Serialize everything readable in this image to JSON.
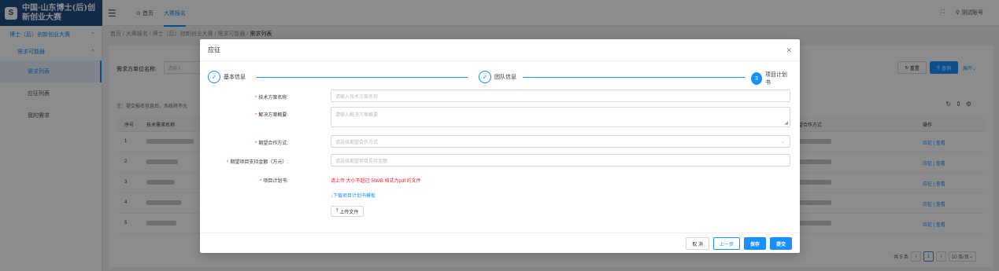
{
  "brand": {
    "logo": "S",
    "title": "中国·山东博士(后)创新创业大赛"
  },
  "header": {
    "tabs": [
      {
        "label": "首页"
      },
      {
        "label": "大赛报名"
      }
    ],
    "account": "测试账号"
  },
  "sidebar": {
    "group": "博士（后）创新创业大赛",
    "sub": "需求可能器",
    "items": [
      {
        "label": "需求列表"
      },
      {
        "label": "应征列表"
      },
      {
        "label": "我的需求"
      }
    ]
  },
  "breadcrumb": "首页 / 大赛报名 / 博士（后）创新创业大赛 / 需求可能器 / ",
  "breadcrumb_last": "需求列表",
  "filter": {
    "label": "需求方单位名称:",
    "placeholder": "请输入",
    "reset": "重置",
    "search": "查询",
    "expand": "展开"
  },
  "notice": "注：提交报名信息后，系统将不允",
  "table": {
    "headers": [
      "序号",
      "技术需求名称",
      "期望合作方式",
      "操作"
    ],
    "rows": [
      {
        "no": "1"
      },
      {
        "no": "2"
      },
      {
        "no": "3"
      },
      {
        "no": "4"
      },
      {
        "no": "5"
      }
    ],
    "op_apply": "应征",
    "op_view": "查看"
  },
  "pager": {
    "total": "共 5 条",
    "page": "1",
    "size": "10 条/页"
  },
  "modal": {
    "title": "应征",
    "steps": [
      {
        "label": "基本信息"
      },
      {
        "label": "团队信息"
      },
      {
        "label": "项目计划书",
        "num": "3"
      }
    ],
    "fields": {
      "name_label": "技术方案名称:",
      "name_placeholder": "请输入技术方案名称",
      "summary_label": "解决方案概要:",
      "summary_placeholder": "请输入解决方案概要",
      "coop_label": "期望合作方式:",
      "coop_placeholder": "请选择期望合作方式",
      "amount_label": "期望项目支持金额（万元）:",
      "amount_placeholder": "请选择期望项目支持金额",
      "plan_label": "项目计划书:"
    },
    "upload_tip": "请上传 大小不超过 50MB 格式为pdf 的文件",
    "download_link": "下载项目计划书模板",
    "upload_button": "上传文件",
    "buttons": {
      "cancel": "取 消",
      "prev": "上一步",
      "save": "保存",
      "submit": "提交"
    }
  }
}
